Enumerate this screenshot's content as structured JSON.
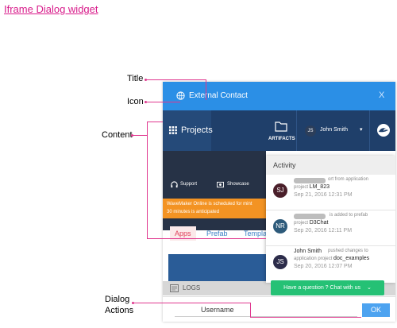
{
  "page": {
    "heading": "Iframe Dialog widget"
  },
  "callouts": {
    "title": "Title",
    "icon": "Icon",
    "content": "Content",
    "actions_line1": "Dialog",
    "actions_line2": "Actions"
  },
  "dialog": {
    "title": "External Contact",
    "close": "X",
    "header_color": "#2b8fe6"
  },
  "topbar": {
    "projects": "Projects",
    "artifacts": "ARTIFACTS",
    "user_initials": "JS",
    "user_name": "John Smith",
    "caret": "▾"
  },
  "panel": {
    "support": "Support",
    "showcase": "Showcase",
    "banner_line1": "WaveMaker Online is scheduled for mint",
    "banner_line2": "30 minutes is anticipated",
    "tabs": [
      "Apps",
      "Prefab",
      "Templa"
    ],
    "logs": "LOGS"
  },
  "activity": {
    "title": "Activity",
    "items": [
      {
        "initials": "SJ",
        "color": "#4a1f2a",
        "text1": "ort from application",
        "text2": "project",
        "project": "LM_823",
        "time": "Sep 21, 2016 12:31 PM"
      },
      {
        "initials": "NR",
        "color": "#2d5a7a",
        "text1": "is added to prefab",
        "text2": "project",
        "project": "D3Chat",
        "time": "Sep 20, 2016 12:11 PM"
      },
      {
        "initials": "JS",
        "color": "#2c2c4a",
        "name": "John Smith",
        "text1": "pushed changes to",
        "text2": "application project",
        "project": "doc_examples",
        "time": "Sep 20, 2016 12:07 PM"
      }
    ]
  },
  "chat": {
    "label": "Have a question ? Chat with us",
    "caret": "⌄"
  },
  "footer": {
    "username_label": "Username",
    "ok": "OK"
  }
}
